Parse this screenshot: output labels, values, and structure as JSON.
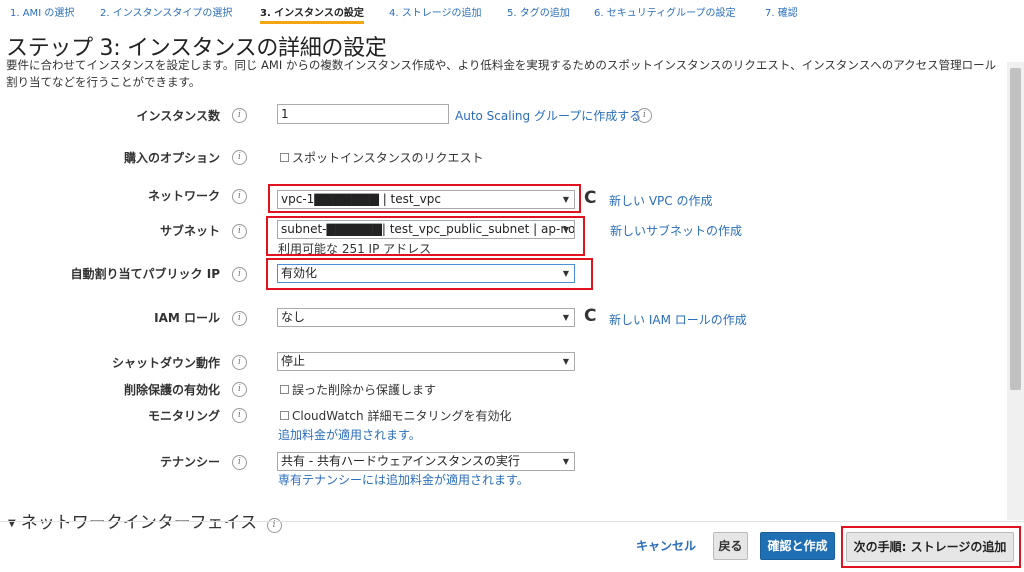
{
  "steps": [
    {
      "label": "1. AMI の選択"
    },
    {
      "label": "2. インスタンスタイプの選択"
    },
    {
      "label": "3. インスタンスの設定"
    },
    {
      "label": "4. ストレージの追加"
    },
    {
      "label": "5. タグの追加"
    },
    {
      "label": "6. セキュリティグループの設定"
    },
    {
      "label": "7. 確認"
    }
  ],
  "active_step": 3,
  "page": {
    "title": "ステップ 3: インスタンスの詳細の設定",
    "description": "要件に合わせてインスタンスを設定します。同じ AMI からの複数インスタンス作成や、より低料金を実現するためのスポットインスタンスのリクエスト、インスタンスへのアクセス管理ロール割り当てなどを行うことができます。"
  },
  "info_glyph": "i",
  "form": {
    "instance_count": {
      "label": "インスタンス数",
      "value": "1",
      "link": "Auto Scaling グループに作成する"
    },
    "purchase_option": {
      "label": "購入のオプション",
      "checkbox": "スポットインスタンスのリクエスト"
    },
    "network": {
      "label": "ネットワーク",
      "value": "vpc-1▇▇▇▇▇▇▇ | test_vpc",
      "link": "新しい VPC の作成"
    },
    "subnet": {
      "label": "サブネット",
      "value": "subnet-▇▇▇▇▇▇| test_vpc_public_subnet | ap-northe",
      "note": "利用可能な 251 IP アドレス",
      "link": "新しいサブネットの作成"
    },
    "auto_public_ip": {
      "label": "自動割り当てパブリック IP",
      "value": "有効化"
    },
    "iam_role": {
      "label": "IAM ロール",
      "value": "なし",
      "link": "新しい IAM ロールの作成"
    },
    "shutdown": {
      "label": "シャットダウン動作",
      "value": "停止"
    },
    "termination_protection": {
      "label": "削除保護の有効化",
      "checkbox": "誤った削除から保護します"
    },
    "monitoring": {
      "label": "モニタリング",
      "checkbox": "CloudWatch 詳細モニタリングを有効化",
      "note": "追加料金が適用されます。"
    },
    "tenancy": {
      "label": "テナンシー",
      "value": "共有 - 共有ハードウェアインスタンスの実行",
      "note": "専有テナンシーには追加料金が適用されます。"
    }
  },
  "section": {
    "network_interfaces": "ネットワークインターフェイス"
  },
  "buttons": {
    "cancel": "キャンセル",
    "back": "戻る",
    "review_launch": "確認と作成",
    "next": "次の手順: ストレージの追加"
  },
  "colors": {
    "accent": "#2a6ebb",
    "primary_button": "#1f6fb5",
    "highlight_box": "#e0141e",
    "active_tab": "#f2a614"
  }
}
